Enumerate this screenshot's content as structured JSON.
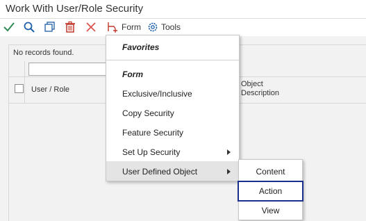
{
  "window": {
    "title": "Work With User/Role Security"
  },
  "toolbar": {
    "form_label": "Form",
    "tools_label": "Tools",
    "icons": [
      "checkmark-icon",
      "search-icon",
      "copy-icon",
      "delete-icon",
      "close-icon",
      "form-icon",
      "tools-gear-icon"
    ],
    "colors": {
      "check": "#2e8b57",
      "search": "#1f5fa8",
      "delete": "#c0392b",
      "close": "#d9534f",
      "gear": "#1f5fa8"
    }
  },
  "grid": {
    "status": "No records found.",
    "filter_value": "",
    "columns": [
      "User / Role",
      "Object Description"
    ]
  },
  "menu": {
    "favorites": "Favorites",
    "form_header": "Form",
    "items": [
      "Exclusive/Inclusive",
      "Copy Security",
      "Feature Security",
      "Set Up Security",
      "User Defined Object"
    ]
  },
  "submenu": {
    "items": [
      "Content",
      "Action",
      "View"
    ],
    "highlight_color": "#1a2f8c"
  }
}
